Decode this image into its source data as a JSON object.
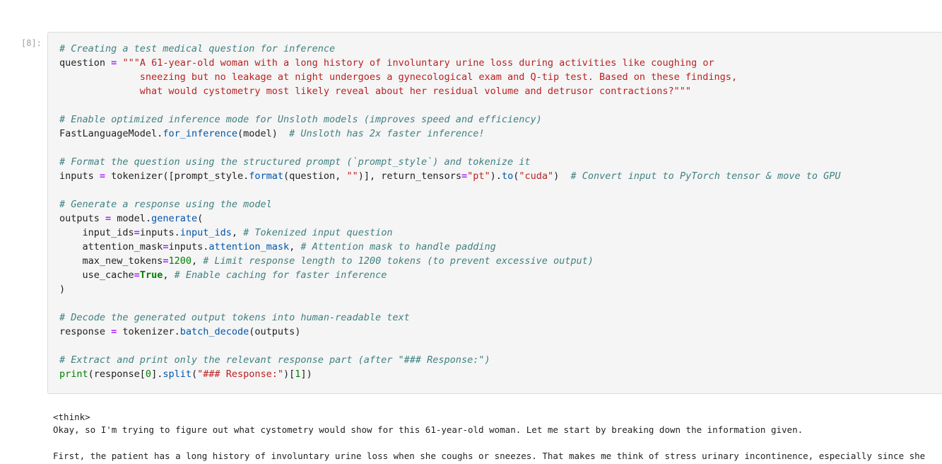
{
  "cell": {
    "prompt": "[8]:",
    "code_lines": [
      [
        {
          "t": "# Creating a test medical question for inference",
          "c": "c"
        }
      ],
      [
        {
          "t": "question ",
          "c": ""
        },
        {
          "t": "=",
          "c": "o"
        },
        {
          "t": " ",
          "c": ""
        },
        {
          "t": "\"\"\"A 61-year-old woman with a long history of involuntary urine loss during activities like coughing or",
          "c": "s"
        }
      ],
      [
        {
          "t": "              sneezing but no leakage at night undergoes a gynecological exam and Q-tip test. Based on these findings,",
          "c": "s"
        }
      ],
      [
        {
          "t": "              what would cystometry most likely reveal about her residual volume and detrusor contractions?\"\"\"",
          "c": "s"
        }
      ],
      [],
      [
        {
          "t": "# Enable optimized inference mode for Unsloth models (improves speed and efficiency)",
          "c": "c"
        }
      ],
      [
        {
          "t": "FastLanguageModel.",
          "c": ""
        },
        {
          "t": "for_inference",
          "c": "f"
        },
        {
          "t": "(model)  ",
          "c": ""
        },
        {
          "t": "# Unsloth has 2x faster inference!",
          "c": "c"
        }
      ],
      [],
      [
        {
          "t": "# Format the question using the structured prompt (`prompt_style`) and tokenize it",
          "c": "c"
        }
      ],
      [
        {
          "t": "inputs ",
          "c": ""
        },
        {
          "t": "=",
          "c": "o"
        },
        {
          "t": " tokenizer([prompt_style.",
          "c": ""
        },
        {
          "t": "format",
          "c": "f"
        },
        {
          "t": "(question, ",
          "c": ""
        },
        {
          "t": "\"\"",
          "c": "s"
        },
        {
          "t": ")], return_tensors",
          "c": ""
        },
        {
          "t": "=",
          "c": "o"
        },
        {
          "t": "\"pt\"",
          "c": "s"
        },
        {
          "t": ").",
          "c": ""
        },
        {
          "t": "to",
          "c": "f"
        },
        {
          "t": "(",
          "c": ""
        },
        {
          "t": "\"cuda\"",
          "c": "s"
        },
        {
          "t": ")  ",
          "c": ""
        },
        {
          "t": "# Convert input to PyTorch tensor & move to GPU",
          "c": "c"
        }
      ],
      [],
      [
        {
          "t": "# Generate a response using the model",
          "c": "c"
        }
      ],
      [
        {
          "t": "outputs ",
          "c": ""
        },
        {
          "t": "=",
          "c": "o"
        },
        {
          "t": " model.",
          "c": ""
        },
        {
          "t": "generate",
          "c": "f"
        },
        {
          "t": "(",
          "c": ""
        }
      ],
      [
        {
          "t": "    input_ids",
          "c": ""
        },
        {
          "t": "=",
          "c": "o"
        },
        {
          "t": "inputs.",
          "c": ""
        },
        {
          "t": "input_ids",
          "c": "a"
        },
        {
          "t": ", ",
          "c": ""
        },
        {
          "t": "# Tokenized input question",
          "c": "c"
        }
      ],
      [
        {
          "t": "    attention_mask",
          "c": ""
        },
        {
          "t": "=",
          "c": "o"
        },
        {
          "t": "inputs.",
          "c": ""
        },
        {
          "t": "attention_mask",
          "c": "a"
        },
        {
          "t": ", ",
          "c": ""
        },
        {
          "t": "# Attention mask to handle padding",
          "c": "c"
        }
      ],
      [
        {
          "t": "    max_new_tokens",
          "c": ""
        },
        {
          "t": "=",
          "c": "o"
        },
        {
          "t": "1200",
          "c": "n"
        },
        {
          "t": ", ",
          "c": ""
        },
        {
          "t": "# Limit response length to 1200 tokens (to prevent excessive output)",
          "c": "c"
        }
      ],
      [
        {
          "t": "    use_cache",
          "c": ""
        },
        {
          "t": "=",
          "c": "o"
        },
        {
          "t": "True",
          "c": "k"
        },
        {
          "t": ", ",
          "c": ""
        },
        {
          "t": "# Enable caching for faster inference",
          "c": "c"
        }
      ],
      [
        {
          "t": ")",
          "c": ""
        }
      ],
      [],
      [
        {
          "t": "# Decode the generated output tokens into human-readable text",
          "c": "c"
        }
      ],
      [
        {
          "t": "response ",
          "c": ""
        },
        {
          "t": "=",
          "c": "o"
        },
        {
          "t": " tokenizer.",
          "c": ""
        },
        {
          "t": "batch_decode",
          "c": "f"
        },
        {
          "t": "(outputs)",
          "c": ""
        }
      ],
      [],
      [
        {
          "t": "# Extract and print only the relevant response part (after \"### Response:\")",
          "c": "c"
        }
      ],
      [
        {
          "t": "print",
          "c": "b"
        },
        {
          "t": "(response[",
          "c": ""
        },
        {
          "t": "0",
          "c": "n"
        },
        {
          "t": "].",
          "c": ""
        },
        {
          "t": "split",
          "c": "f"
        },
        {
          "t": "(",
          "c": ""
        },
        {
          "t": "\"### Response:\"",
          "c": "s"
        },
        {
          "t": ")[",
          "c": ""
        },
        {
          "t": "1",
          "c": "n"
        },
        {
          "t": "])",
          "c": ""
        }
      ]
    ]
  },
  "output": {
    "lines": [
      "<think>",
      "Okay, so I'm trying to figure out what cystometry would show for this 61-year-old woman. Let me start by breaking down the information given.",
      "",
      "First, the patient has a long history of involuntary urine loss when she coughs or sneezes. That makes me think of stress urinary incontinence, especially since she"
    ]
  }
}
